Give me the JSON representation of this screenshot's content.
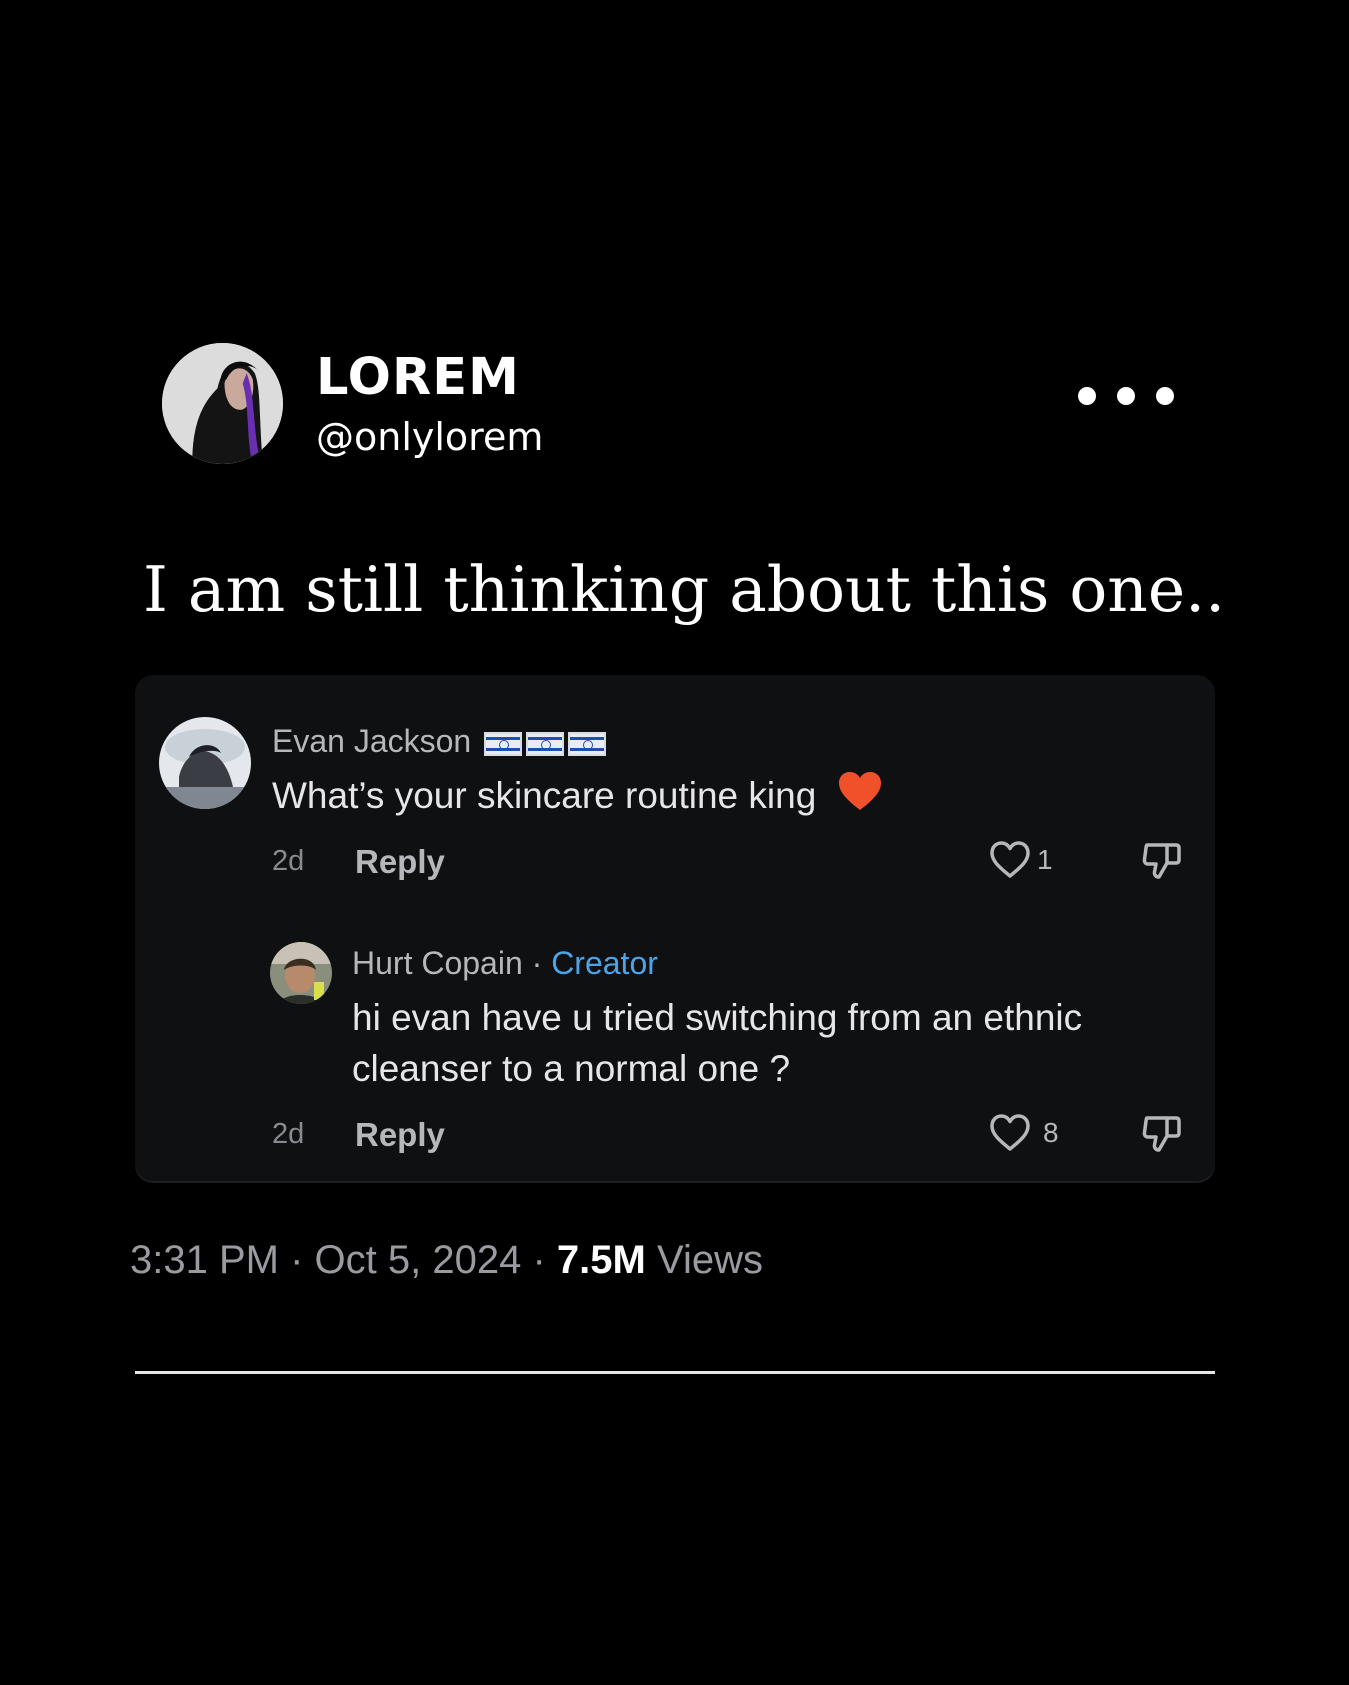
{
  "author": {
    "display_name": "LOREM",
    "handle": "@onlylorem"
  },
  "post": {
    "text": "I am still thinking about this one.."
  },
  "comments": [
    {
      "name": "Evan Jackson",
      "flags": [
        "israel-flag",
        "israel-flag",
        "israel-flag"
      ],
      "text": "What’s your skincare routine king",
      "emoji": "orange-heart",
      "age": "2d",
      "reply_label": "Reply",
      "likes": "1"
    },
    {
      "name": "Hurt Copain",
      "separator": "·",
      "badge": "Creator",
      "text_line1": "hi evan have u tried switching from an ethnic",
      "text_line2": "cleanser to a normal one ?",
      "age": "2d",
      "reply_label": "Reply",
      "likes": "8"
    }
  ],
  "footer": {
    "time": "3:31 PM",
    "sep1": "·",
    "date": "Oct 5, 2024",
    "sep2": "·",
    "views_count": "7.5M",
    "views_label": "Views"
  },
  "colors": {
    "background": "#000000",
    "card": "#0f1012",
    "creator": "#4ea3e6",
    "heart_emoji": "#f0502a"
  }
}
